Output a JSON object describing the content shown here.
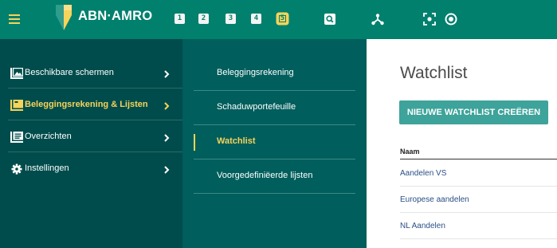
{
  "topbar": {
    "brand": "ABN·AMRO",
    "screens": [
      {
        "label": "1",
        "active": false
      },
      {
        "label": "2",
        "active": false
      },
      {
        "label": "3",
        "active": false
      },
      {
        "label": "4",
        "active": false
      },
      {
        "label": "5",
        "active": true
      }
    ],
    "tools": [
      "search-icon",
      "network-icon",
      "focus-icon",
      "target-icon"
    ],
    "colors": {
      "bar": "#00806d",
      "accent": "#f6d35a"
    }
  },
  "menu": {
    "items": [
      {
        "label": "Beschikbare schermen",
        "icon": "screens-icon",
        "active": false
      },
      {
        "label": "Beleggingsrekening & Lijsten",
        "icon": "folders-icon",
        "active": true
      },
      {
        "label": "Overzichten",
        "icon": "document-icon",
        "active": false
      },
      {
        "label": "Instellingen",
        "icon": "gear-icon",
        "active": false
      }
    ]
  },
  "submenu": {
    "items": [
      {
        "label": "Beleggingsrekening",
        "active": false
      },
      {
        "label": "Schaduwportefeuille",
        "active": false
      },
      {
        "label": "Watchlist",
        "active": true
      },
      {
        "label": "Voorgedefiniëerde lijsten",
        "active": false
      }
    ]
  },
  "main": {
    "title": "Watchlist",
    "new_button": "NIEUWE WATCHLIST CREËREN",
    "column_header": "Naam",
    "rows": [
      "Aandelen VS",
      "Europese aandelen",
      "NL Aandelen"
    ]
  }
}
